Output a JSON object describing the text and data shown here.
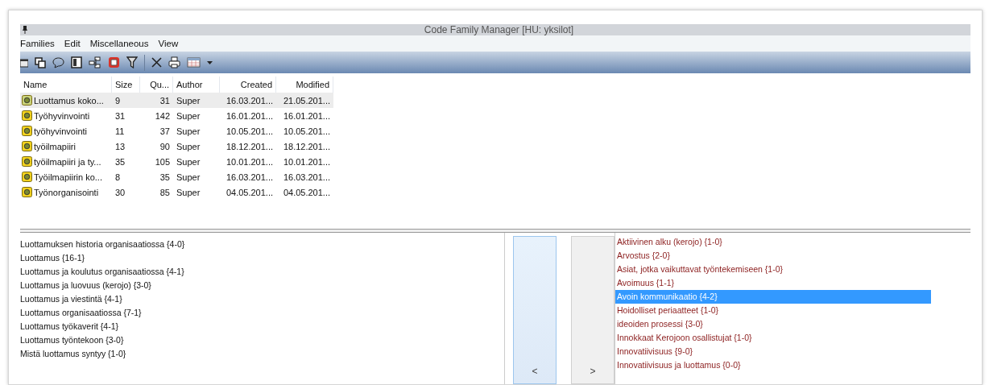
{
  "window": {
    "title": "Code Family Manager [HU: yksilot]"
  },
  "menu": [
    "Families",
    "Edit",
    "Miscellaneous",
    "View"
  ],
  "toolbar": [
    {
      "kind": "folder"
    },
    {
      "kind": "copy"
    },
    {
      "kind": "comment"
    },
    {
      "kind": "document"
    },
    {
      "kind": "tree"
    },
    {
      "kind": "stop"
    },
    {
      "kind": "filter"
    },
    {
      "kind": "separator"
    },
    {
      "kind": "delete"
    },
    {
      "kind": "print"
    },
    {
      "kind": "table"
    },
    {
      "kind": "dropdown"
    }
  ],
  "table": {
    "columns": [
      "Name",
      "Size",
      "Qu...",
      "Author",
      "Created",
      "Modified"
    ],
    "rows": [
      {
        "selected": true,
        "cells": [
          "Luottamus koko...",
          "9",
          "31",
          "Super",
          "16.03.201...",
          "21.05.201..."
        ]
      },
      {
        "selected": false,
        "cells": [
          "Työhyvinvointi",
          "31",
          "142",
          "Super",
          "16.01.201...",
          "16.01.201..."
        ]
      },
      {
        "selected": false,
        "cells": [
          "työhyvinvointi",
          "11",
          "37",
          "Super",
          "10.05.201...",
          "10.05.201..."
        ]
      },
      {
        "selected": false,
        "cells": [
          "työilmapiiri",
          "13",
          "90",
          "Super",
          "18.12.201...",
          "18.12.201..."
        ]
      },
      {
        "selected": false,
        "cells": [
          "työilmapiiri ja ty...",
          "35",
          "105",
          "Super",
          "10.01.201...",
          "10.01.201..."
        ]
      },
      {
        "selected": false,
        "cells": [
          "Työilmapiirin ko...",
          "8",
          "35",
          "Super",
          "16.03.201...",
          "16.03.201..."
        ]
      },
      {
        "selected": false,
        "cells": [
          "Työnorganisointi",
          "30",
          "85",
          "Super",
          "04.05.201...",
          "04.05.201..."
        ]
      }
    ]
  },
  "family_codes": [
    "Luottamuksen historia organisaatiossa {4-0}",
    "Luottamus {16-1}",
    "Luottamus ja koulutus organisaatiossa {4-1}",
    "Luottamus ja luovuus (kerojo) {3-0}",
    "Luottamus ja viestintä {4-1}",
    "Luottamus organisaatiossa {7-1}",
    "Luottamus työkaverit {4-1}",
    "Luottamus työntekoon {3-0}",
    "Mistä luottamus syntyy {1-0}"
  ],
  "buttons": [
    {
      "label": "<",
      "hover": true
    },
    {
      "label": ">",
      "hover": false
    }
  ],
  "all_codes": [
    {
      "label": "Aktiivinen alku (kerojo) {1-0}",
      "selected": false
    },
    {
      "label": "Arvostus {2-0}",
      "selected": false
    },
    {
      "label": "Asiat, jotka vaikuttavat työntekemiseen {1-0}",
      "selected": false
    },
    {
      "label": "Avoimuus {1-1}",
      "selected": false
    },
    {
      "label": "Avoin kommunikaatio {4-2}",
      "selected": true
    },
    {
      "label": "Hoidolliset periaatteet {1-0}",
      "selected": false
    },
    {
      "label": "ideoiden prosessi {3-0}",
      "selected": false
    },
    {
      "label": "Innokkaat Kerojoon osallistujat {1-0}",
      "selected": false
    },
    {
      "label": "Innovatiivisuus {9-0}",
      "selected": false
    },
    {
      "label": "Innovatiivisuus ja luottamus {0-0}",
      "selected": false
    }
  ]
}
